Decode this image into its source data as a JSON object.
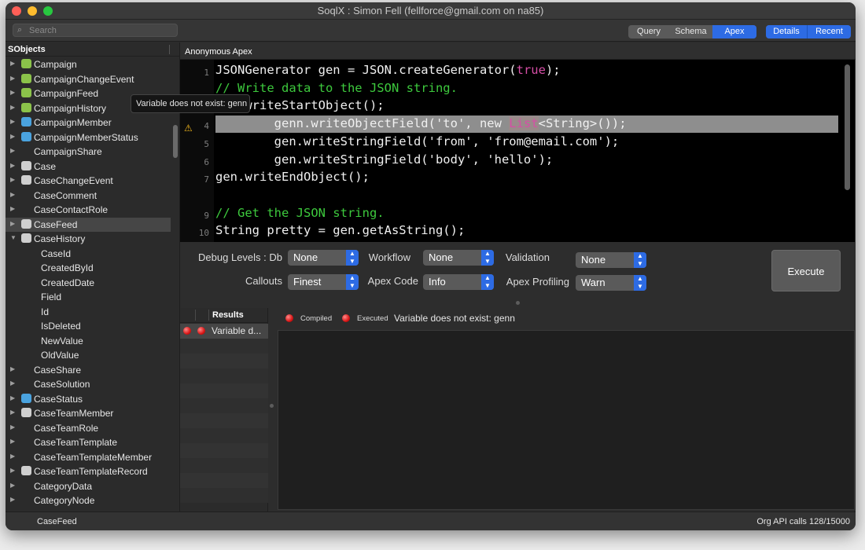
{
  "window": {
    "title": "SoqlX : Simon Fell (fellforce@gmail.com on na85)"
  },
  "toolbar": {
    "search_placeholder": "Search",
    "view_tabs": [
      "Query",
      "Schema",
      "Apex"
    ],
    "active_view": "Apex",
    "panel_tabs": [
      "Details",
      "Recent"
    ]
  },
  "sidebar": {
    "header": "SObjects",
    "items": [
      {
        "label": "Campaign",
        "icon": "campaign-icon",
        "icon_color": "#8bc34a"
      },
      {
        "label": "CampaignChangeEvent",
        "icon": "campaign-icon",
        "icon_color": "#8bc34a"
      },
      {
        "label": "CampaignFeed",
        "icon": "campaign-icon",
        "icon_color": "#8bc34a"
      },
      {
        "label": "CampaignHistory",
        "icon": "campaign-icon",
        "icon_color": "#8bc34a"
      },
      {
        "label": "CampaignMember",
        "icon": "member-icon",
        "icon_color": "#4aa3df"
      },
      {
        "label": "CampaignMemberStatus",
        "icon": "member-icon",
        "icon_color": "#4aa3df"
      },
      {
        "label": "CampaignShare",
        "icon": "",
        "icon_color": ""
      },
      {
        "label": "Case",
        "icon": "case-icon",
        "icon_color": "#cfcfcf"
      },
      {
        "label": "CaseChangeEvent",
        "icon": "case-icon",
        "icon_color": "#cfcfcf"
      },
      {
        "label": "CaseComment",
        "icon": "",
        "icon_color": ""
      },
      {
        "label": "CaseContactRole",
        "icon": "",
        "icon_color": ""
      },
      {
        "label": "CaseFeed",
        "icon": "case-icon",
        "icon_color": "#cfcfcf"
      },
      {
        "label": "CaseHistory",
        "icon": "case-icon",
        "icon_color": "#cfcfcf"
      },
      {
        "label": "CaseId",
        "child": true
      },
      {
        "label": "CreatedById",
        "child": true
      },
      {
        "label": "CreatedDate",
        "child": true
      },
      {
        "label": "Field",
        "child": true
      },
      {
        "label": "Id",
        "child": true
      },
      {
        "label": "IsDeleted",
        "child": true
      },
      {
        "label": "NewValue",
        "child": true
      },
      {
        "label": "OldValue",
        "child": true
      },
      {
        "label": "CaseShare",
        "icon": "",
        "icon_color": ""
      },
      {
        "label": "CaseSolution",
        "icon": "",
        "icon_color": ""
      },
      {
        "label": "CaseStatus",
        "icon": "status-icon",
        "icon_color": "#4aa3df"
      },
      {
        "label": "CaseTeamMember",
        "icon": "case-icon",
        "icon_color": "#cfcfcf"
      },
      {
        "label": "CaseTeamRole",
        "icon": "",
        "icon_color": ""
      },
      {
        "label": "CaseTeamTemplate",
        "icon": "",
        "icon_color": ""
      },
      {
        "label": "CaseTeamTemplateMember",
        "icon": "",
        "icon_color": ""
      },
      {
        "label": "CaseTeamTemplateRecord",
        "icon": "case-icon",
        "icon_color": "#cfcfcf"
      },
      {
        "label": "CategoryData",
        "icon": "",
        "icon_color": ""
      },
      {
        "label": "CategoryNode",
        "icon": "",
        "icon_color": ""
      }
    ],
    "selected": "CaseFeed",
    "expanded": "CaseHistory"
  },
  "editor": {
    "header": "Anonymous Apex",
    "line_numbers": [
      "1",
      "",
      "",
      "4",
      "5",
      "6",
      "7",
      "",
      "9",
      "10"
    ],
    "lines": [
      "JSONGenerator gen = JSON.createGenerator(true);",
      "// Write data to the JSON string.",
      "gen.writeStartObject();",
      "        genn.writeObjectField('to', new List<String>());",
      "        gen.writeStringField('from', 'from@email.com');",
      "        gen.writeStringField('body', 'hello');",
      "gen.writeEndObject();",
      "",
      "// Get the JSON string.",
      "String pretty = gen.getAsString();"
    ],
    "error_line": 4,
    "tooltip": "Variable does not exist: genn"
  },
  "debug_settings": {
    "debug_levels_db_label": "Debug Levels : Db",
    "debug_levels_db_value": "None",
    "workflow_label": "Workflow",
    "workflow_value": "None",
    "validation_label": "Validation",
    "validation_value": "None",
    "callouts_label": "Callouts",
    "callouts_value": "Finest",
    "apex_code_label": "Apex Code",
    "apex_code_value": "Info",
    "apex_profiling_label": "Apex Profiling",
    "apex_profiling_value": "Warn",
    "execute_label": "Execute"
  },
  "results": {
    "header": "Results",
    "rows": [
      "Variable d..."
    ],
    "compiled_label": "Compiled",
    "executed_label": "Executed",
    "message": "Variable does not exist: genn"
  },
  "footer": {
    "selected_object": "CaseFeed",
    "api_calls": "Org API calls 128/15000"
  },
  "colors": {
    "accent": "#2d6be4",
    "error": "#d81515",
    "comment": "#3dc93d",
    "keyword": "#d64ea6"
  }
}
